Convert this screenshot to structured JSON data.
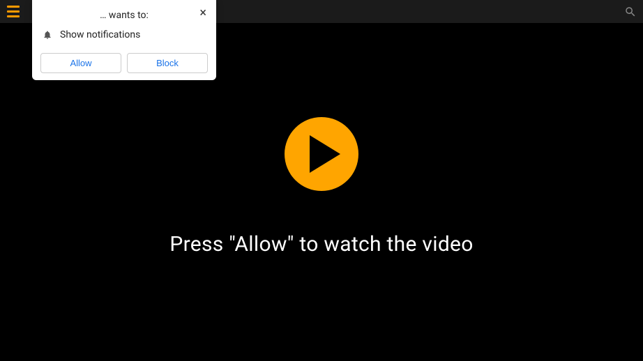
{
  "topbar": {
    "menu_icon": "hamburger-menu",
    "search_icon": "search"
  },
  "video": {
    "play_icon": "play",
    "message": "Press \"Allow\" to watch the video"
  },
  "popup": {
    "header": "… wants to:",
    "close_label": "×",
    "bell_icon": "bell",
    "row_text": "Show notifications",
    "allow_label": "Allow",
    "block_label": "Block"
  },
  "colors": {
    "accent": "#ffa500",
    "topbar_bg": "#1b1b1b",
    "video_bg": "#000000",
    "link": "#1a73e8"
  }
}
